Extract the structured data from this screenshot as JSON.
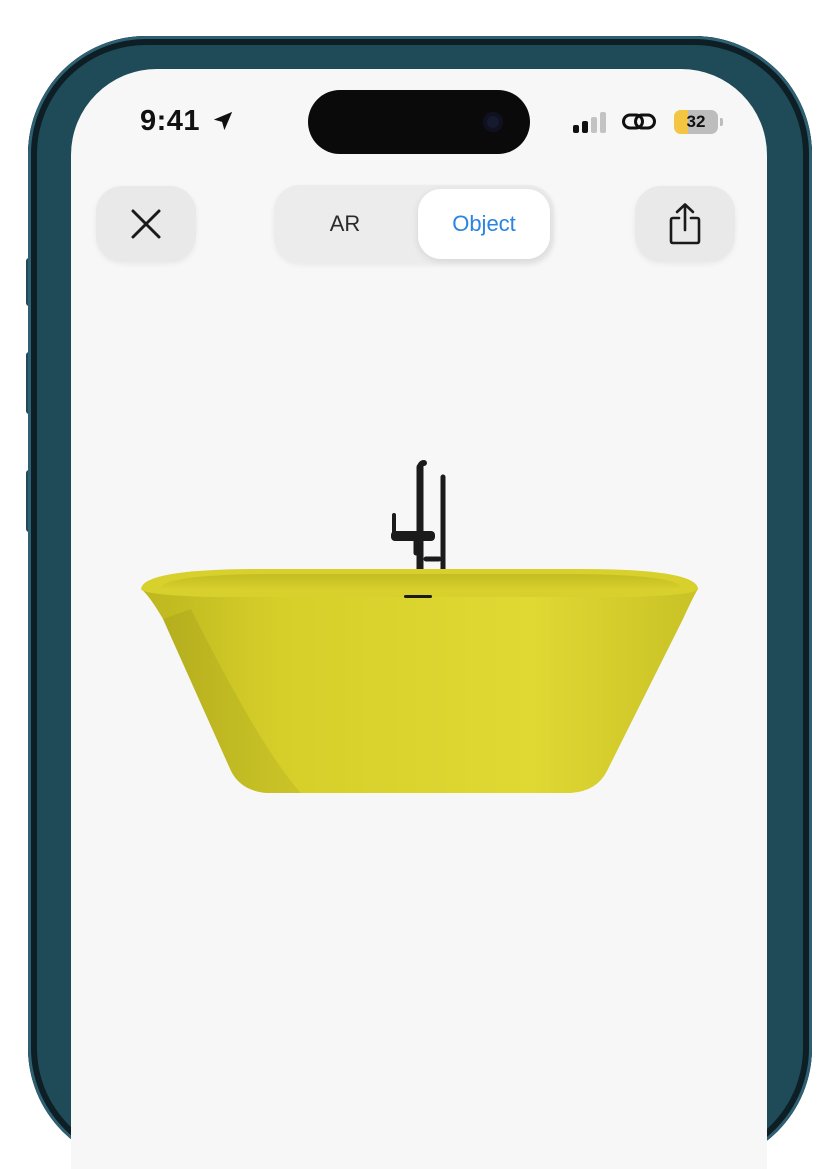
{
  "status_bar": {
    "time": "9:41",
    "location_icon": "location-arrow-icon",
    "signal_icon": "cellular-signal-icon",
    "signal_bars_active": 2,
    "signal_bars_total": 4,
    "link_icon": "link-icon",
    "battery_level": "32",
    "battery_color": "#f4c542"
  },
  "toolbar": {
    "close_icon": "close-icon",
    "share_icon": "share-icon",
    "segments": [
      {
        "label": "AR",
        "selected": false
      },
      {
        "label": "Object",
        "selected": true
      }
    ],
    "accent_color": "#2a84e0"
  },
  "viewer": {
    "object": "bathtub-model",
    "object_color": "#dcd52f",
    "faucet_color": "#1b1b1b"
  },
  "device": {
    "frame_color": "#1f4a57"
  }
}
